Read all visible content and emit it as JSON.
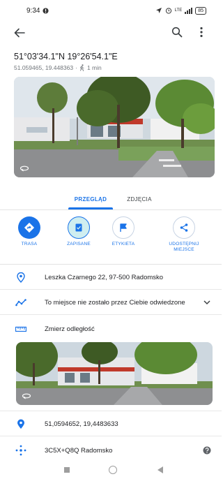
{
  "status_bar": {
    "time": "9:34",
    "signal_text": "LTE",
    "battery": "85"
  },
  "place": {
    "title": "51°03'34.1\"N 19°26'54.1\"E",
    "decimal_coords": "51.059465, 19.448363",
    "walk_time": "1 min"
  },
  "tabs": [
    {
      "label": "PRZEGLĄD"
    },
    {
      "label": "ZDJĘCIA"
    }
  ],
  "actions": [
    {
      "label": "TRASA",
      "icon": "directions-icon"
    },
    {
      "label": "ZAPISANE",
      "icon": "bookmark-icon"
    },
    {
      "label": "ETYKIETA",
      "icon": "flag-icon"
    },
    {
      "label": "UDOSTĘPNIJ",
      "label2": "MIEJSCE",
      "icon": "share-icon"
    }
  ],
  "rows": {
    "address": "Leszka Czarnego 22, 97-500 Radomsko",
    "timeline": "To miejsce nie zostało przez Ciebie odwiedzone",
    "measure": "Zmierz odległość",
    "coords": "51,0594652, 19,4483633",
    "plus_code": "3C5X+Q8Q Radomsko"
  },
  "colors": {
    "accent": "#1a73e8",
    "saved_fill": "#cfeef0",
    "text": "#202124",
    "secondary_text": "#70757a"
  }
}
